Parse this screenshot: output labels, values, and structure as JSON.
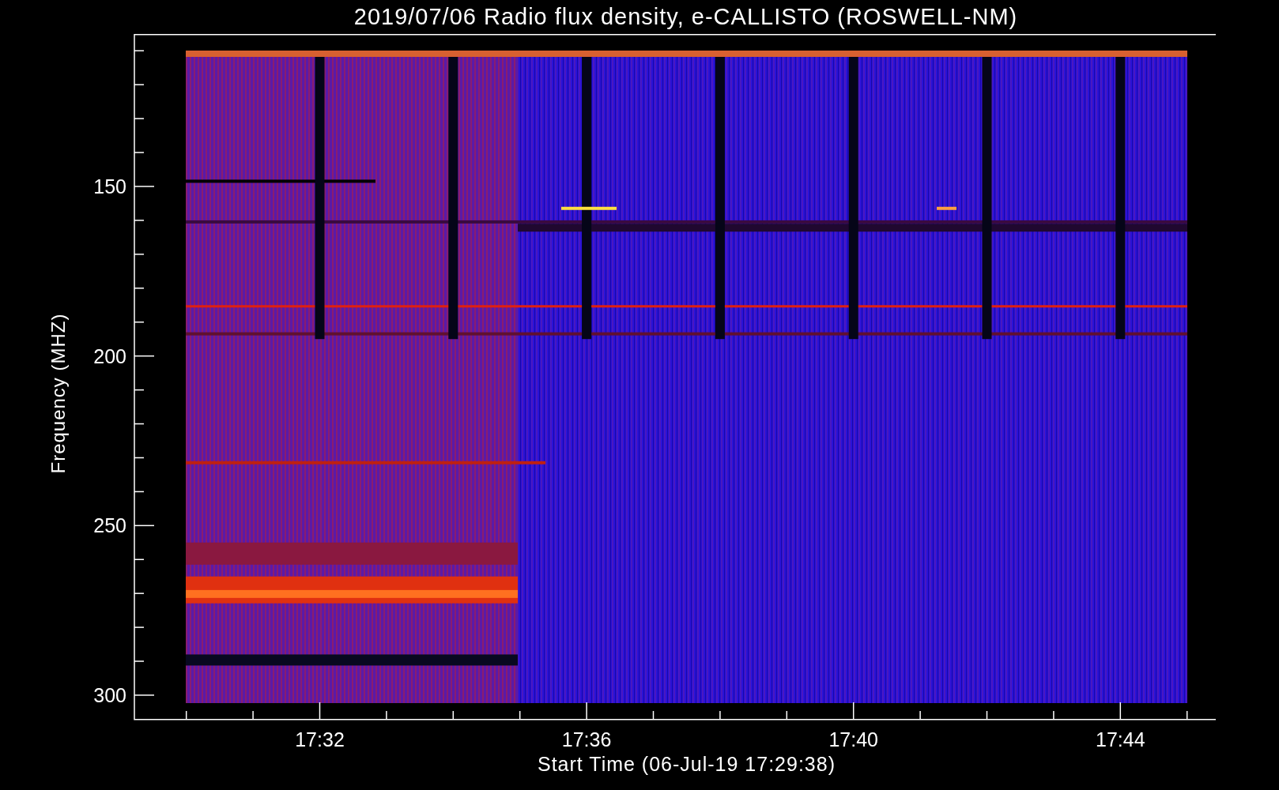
{
  "title": "2019/07/06  Radio flux density, e-CALLISTO (ROSWELL-NM)",
  "y_axis": {
    "label": "Frequency (MHZ)",
    "ticks": [
      "150",
      "200",
      "250",
      "300"
    ]
  },
  "x_axis": {
    "label": "Start Time (06-Jul-19 17:29:38)",
    "ticks": [
      "17:32",
      "17:36",
      "17:40",
      "17:44"
    ]
  }
}
